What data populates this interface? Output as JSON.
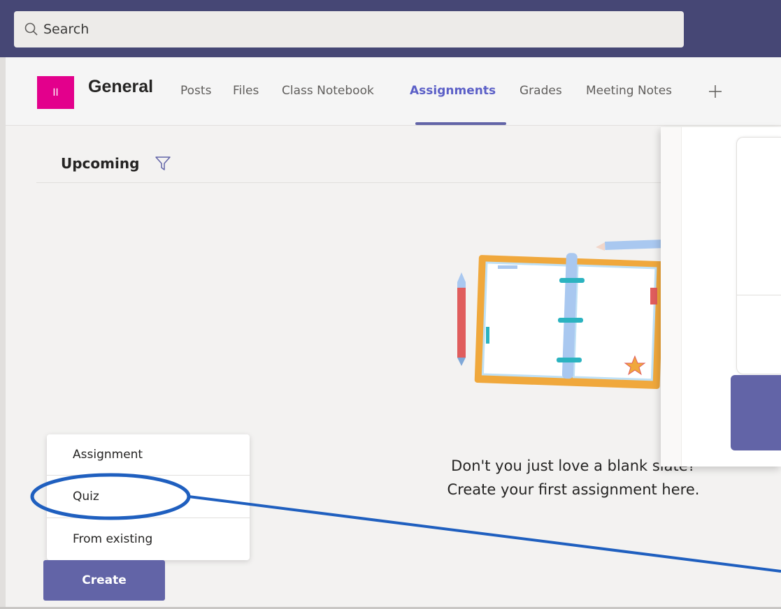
{
  "search": {
    "placeholder": "Search"
  },
  "channel": {
    "avatar_initials": "II",
    "title": "General",
    "tabs": [
      {
        "label": "Posts",
        "active": false
      },
      {
        "label": "Files",
        "active": false
      },
      {
        "label": "Class Notebook",
        "active": false
      },
      {
        "label": "Assignments",
        "active": true
      },
      {
        "label": "Grades",
        "active": false
      },
      {
        "label": "Meeting Notes",
        "active": false
      }
    ],
    "add_tab_icon": "plus-icon"
  },
  "assignments": {
    "section_label": "Upcoming",
    "filter_icon": "filter-icon",
    "empty_line1": "Don't you just love a blank slate?",
    "empty_line2": "Create your first assignment here."
  },
  "create_menu": {
    "items": [
      {
        "label": "Assignment"
      },
      {
        "label": "Quiz"
      },
      {
        "label": "From existing"
      }
    ],
    "create_label": "Create"
  },
  "colors": {
    "topbar": "#464775",
    "accent": "#6264a7",
    "avatar": "#e3008c",
    "annotation": "#1f5fbf"
  }
}
